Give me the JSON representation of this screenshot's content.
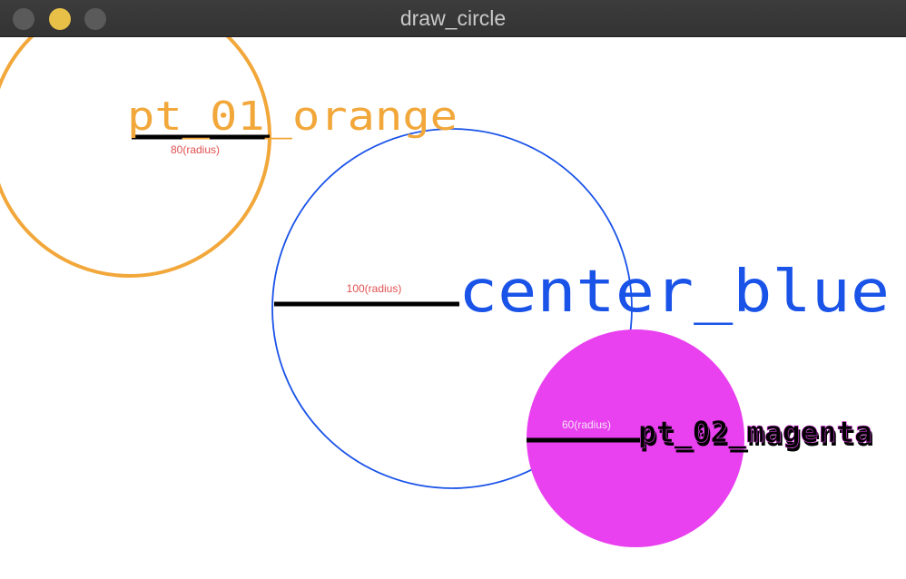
{
  "window": {
    "title": "draw_circle"
  },
  "colors": {
    "orange": "#f2a73a",
    "blue": "#1a53e8",
    "magenta": "#e940f0",
    "radius_label_red": "#e05050",
    "radius_label_light": "#f4e6f4",
    "line": "#000000"
  },
  "circles": {
    "orange": {
      "name": "pt_01_orange",
      "radius_label": "80(radius)"
    },
    "blue": {
      "name": "center_blue",
      "radius_label": "100(radius)"
    },
    "magenta": {
      "name": "pt_02_magenta",
      "radius_label": "60(radius)"
    }
  }
}
